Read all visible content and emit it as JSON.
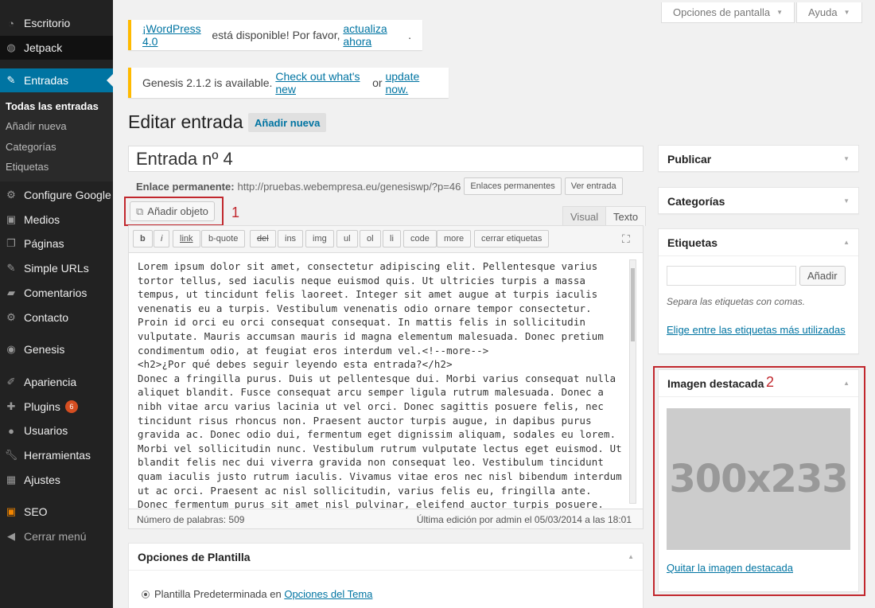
{
  "sidebar": {
    "items": [
      {
        "label": "Escritorio",
        "icon": "dashboard-icon"
      },
      {
        "label": "Jetpack",
        "icon": "jetpack-icon"
      },
      {
        "label": "Entradas",
        "icon": "pin-icon"
      },
      {
        "label": "Configure Google",
        "icon": "gear-icon"
      },
      {
        "label": "Medios",
        "icon": "media-icon"
      },
      {
        "label": "Páginas",
        "icon": "pages-icon"
      },
      {
        "label": "Simple URLs",
        "icon": "pin-icon"
      },
      {
        "label": "Comentarios",
        "icon": "comment-icon"
      },
      {
        "label": "Contacto",
        "icon": "gear-icon"
      },
      {
        "label": "Genesis",
        "icon": "genesis-icon"
      },
      {
        "label": "Apariencia",
        "icon": "brush-icon"
      },
      {
        "label": "Plugins",
        "icon": "plugin-icon",
        "badge": "6"
      },
      {
        "label": "Usuarios",
        "icon": "user-icon"
      },
      {
        "label": "Herramientas",
        "icon": "wrench-icon"
      },
      {
        "label": "Ajustes",
        "icon": "settings-icon"
      },
      {
        "label": "SEO",
        "icon": "seo-icon"
      },
      {
        "label": "Cerrar menú",
        "icon": "collapse-icon"
      }
    ],
    "submenu": [
      "Todas las entradas",
      "Añadir nueva",
      "Categorías",
      "Etiquetas"
    ]
  },
  "header": {
    "screen_options": "Opciones de pantalla",
    "help": "Ayuda"
  },
  "notices": {
    "wp_update_link": "¡WordPress 4.0",
    "wp_update_mid": " está disponible! Por favor, ",
    "wp_update_action": "actualiza ahora",
    "wp_update_end": ".",
    "genesis_text": "Genesis 2.1.2 is available. ",
    "genesis_link1": "Check out what's new",
    "genesis_or": " or ",
    "genesis_link2": "update now."
  },
  "page": {
    "title": "Editar entrada",
    "add_new": "Añadir nueva"
  },
  "post": {
    "title": "Entrada nº 4",
    "permalink_label": "Enlace permanente:",
    "permalink_url": "http://pruebas.webempresa.eu/genesiswp/?p=46",
    "permalinks_button": "Enlaces permanentes",
    "view_button": "Ver entrada"
  },
  "editor": {
    "add_media": "Añadir objeto",
    "tab_visual": "Visual",
    "tab_text": "Texto",
    "quicktags": [
      "b",
      "i",
      "link",
      "b-quote",
      "del",
      "ins",
      "img",
      "ul",
      "ol",
      "li",
      "code",
      "more",
      "cerrar etiquetas"
    ],
    "content": "Lorem ipsum dolor sit amet, consectetur adipiscing elit. Pellentesque varius tortor tellus, sed iaculis neque euismod quis. Ut ultricies turpis a massa tempus, ut tincidunt felis laoreet. Integer sit amet augue at turpis iaculis venenatis eu a turpis. Vestibulum venenatis odio ornare tempor consectetur. Proin id orci eu orci consequat consequat. In mattis felis in sollicitudin vulputate. Mauris accumsan mauris id magna elementum malesuada. Donec pretium condimentum odio, at feugiat eros interdum vel.<!--more-->\n<h2>¿Por qué debes seguir leyendo esta entrada?</h2>\nDonec a fringilla purus. Duis ut pellentesque dui. Morbi varius consequat nulla aliquet blandit. Fusce consequat arcu semper ligula rutrum malesuada. Donec a nibh vitae arcu varius lacinia ut vel orci. Donec sagittis posuere felis, nec tincidunt risus rhoncus non. Praesent auctor turpis augue, in dapibus purus gravida ac. Donec odio dui, fermentum eget dignissim aliquam, sodales eu lorem. Morbi vel sollicitudin nunc. Vestibulum rutrum vulputate lectus eget euismod. Ut blandit felis nec dui viverra gravida non consequat leo. Vestibulum tincidunt quam iaculis justo rutrum iaculis. Vivamus vitae eros nec nisl bibendum interdum ut ac orci. Praesent ac nisl sollicitudin, varius felis eu, fringilla ante. Donec fermentum purus sit amet nisl pulvinar, eleifend auctor turpis posuere.",
    "word_count": "Número de palabras: 509",
    "last_edit": "Última edición por admin el 05/03/2014 a las 18:01"
  },
  "template_box": {
    "title": "Opciones de Plantilla",
    "option_text": "Plantilla Predeterminada en ",
    "option_link": "Opciones del Tema"
  },
  "boxes": {
    "publish": "Publicar",
    "categories": "Categorías",
    "tags": "Etiquetas",
    "tags_add": "Añadir",
    "tags_hint": "Separa las etiquetas con comas.",
    "tags_choose": "Elige entre las etiquetas más utilizadas",
    "featured": "Imagen destacada",
    "featured_placeholder": "300x233",
    "featured_remove": "Quitar la imagen destacada"
  },
  "annotations": {
    "one": "1",
    "two": "2"
  }
}
